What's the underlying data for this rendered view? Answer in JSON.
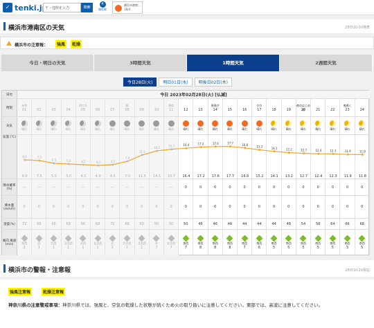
{
  "header": {
    "logo_text": "tenki.jp",
    "search_placeholder": "〒・住所を入力",
    "search_button": "検索",
    "notice_count": "4",
    "notice_label": "現在地",
    "mini_forecast": "横浜市港南... 18/4"
  },
  "page": {
    "title": "横浜市港南区の天気",
    "time": "28日10:00発表"
  },
  "warnings": {
    "label": "横浜市の注意報：",
    "items": [
      "強風",
      "乾燥"
    ]
  },
  "tabs": [
    "今日・明日の天気",
    "3時間天気",
    "1時間天気",
    "2週間天気"
  ],
  "active_tab": 2,
  "subtabs": [
    "今日28日(火)",
    "明日01日(水)",
    "明後日02日(木)"
  ],
  "table": {
    "date_label": "日付",
    "date_value": "今日 2023年02月28日(火) [仏滅]",
    "row_labels": {
      "hour": "時刻",
      "weather": "天気",
      "temp": "気温 (℃)",
      "precip_prob": "降水確率 (%)",
      "precip": "降水量 (mm/h)",
      "humidity": "湿度(%)",
      "wind": "風向 風速 (m/s)"
    },
    "periods": [
      "未明",
      "",
      "",
      "",
      "明け方",
      "",
      "",
      "朝",
      "",
      "",
      "昼前",
      "",
      "",
      "昼過ぎ",
      "",
      "",
      "夕方",
      "",
      "",
      "夜のはじめ頃",
      "",
      "",
      "夜遅く",
      ""
    ],
    "hours": [
      "01",
      "02",
      "03",
      "04",
      "05",
      "06",
      "07",
      "08",
      "09",
      "10",
      "11",
      "12",
      "13",
      "14",
      "15",
      "16",
      "17",
      "18",
      "19",
      "20",
      "21",
      "22",
      "23",
      "24"
    ],
    "weather": [
      "晴れ",
      "晴れ",
      "晴れ",
      "晴れ",
      "晴れ",
      "晴れ",
      "晴れ",
      "晴れ",
      "晴れ",
      "晴れ",
      "晴れ",
      "晴れ",
      "晴れ",
      "晴れ",
      "晴れ",
      "晴れ",
      "晴れ",
      "晴れ",
      "晴れ",
      "晴れ",
      "晴れ",
      "晴れ",
      "晴れ",
      "晴れ"
    ],
    "weather_icons": [
      "moon-icon",
      "moon-icon",
      "moon-icon",
      "moon-icon",
      "moon-icon",
      "moon-icon",
      "sun-icon",
      "sun-icon",
      "sun-icon",
      "sun-icon",
      "sun-icon",
      "sun-icon",
      "sun-icon",
      "sun-icon",
      "sun-icon",
      "sun-icon",
      "sun-icon",
      "moon-icon",
      "moon-icon",
      "moon-icon",
      "moon-icon",
      "moon-icon",
      "moon-icon",
      "moon-icon"
    ],
    "temps": [
      "8.0",
      "7.5",
      "5.5",
      "5.0",
      "4.5",
      "4.0",
      "4.5",
      "7.0",
      "11.5",
      "14.5",
      "15.7",
      "16.4",
      "17.2",
      "17.6",
      "17.7",
      "16.6",
      "15.2",
      "14.1",
      "13.2",
      "12.7",
      "12.4",
      "12.3",
      "11.9",
      "11.8"
    ],
    "temp_axis": [
      "最高",
      "20",
      "15",
      "10",
      "5",
      "0",
      "最低"
    ],
    "precip_prob": [
      "---",
      "---",
      "---",
      "---",
      "---",
      "---",
      "---",
      "---",
      "---",
      "---",
      "---",
      "0",
      "0",
      "0",
      "0",
      "0",
      "0",
      "0",
      "0",
      "0",
      "0",
      "0",
      "0",
      "0"
    ],
    "precip": [
      "0",
      "0",
      "0",
      "0",
      "0",
      "0",
      "0",
      "0",
      "0",
      "0",
      "0",
      "0",
      "0",
      "0",
      "0",
      "0",
      "0",
      "0",
      "0",
      "0",
      "0",
      "0",
      "0",
      "0"
    ],
    "humidity": [
      "72",
      "68",
      "66",
      "68",
      "66",
      "68",
      "70",
      "68",
      "60",
      "50",
      "50",
      "50",
      "46",
      "46",
      "46",
      "44",
      "44",
      "44",
      "48",
      "54",
      "58",
      "64",
      "66",
      "68"
    ],
    "wind_dir": [
      "南西",
      "西",
      "北西",
      "北北西",
      "北西",
      "北北西",
      "北",
      "北北西",
      "北北西",
      "北",
      "北北西",
      "南西",
      "南西",
      "南西",
      "南西",
      "南西",
      "南西",
      "南西",
      "南西",
      "南西",
      "南西",
      "南西",
      "南西",
      "南西"
    ],
    "wind_speed": [
      "2",
      "1",
      "1",
      "1",
      "1",
      "1",
      "1",
      "1",
      "1",
      "7",
      "7",
      "7",
      "8",
      "8",
      "8",
      "7",
      "6",
      "5",
      "5",
      "5",
      "5",
      "5",
      "5",
      "5"
    ]
  },
  "chart_data": {
    "type": "line",
    "x": [
      "01",
      "02",
      "03",
      "04",
      "05",
      "06",
      "07",
      "08",
      "09",
      "10",
      "11",
      "12",
      "13",
      "14",
      "15",
      "16",
      "17",
      "18",
      "19",
      "20",
      "21",
      "22",
      "23",
      "24"
    ],
    "series": [
      {
        "values": [
          8.0,
          7.5,
          5.5,
          5.0,
          4.5,
          4.0,
          4.5,
          7.0,
          11.5,
          14.5,
          15.7,
          16.4,
          17.2,
          17.6,
          17.7,
          16.6,
          15.2,
          14.1,
          13.2,
          12.7,
          12.4,
          12.3,
          11.9,
          11.8
        ]
      }
    ],
    "ylim": [
      0,
      20
    ],
    "color": "#f5a623"
  },
  "alert": {
    "title": "横浜市の警報・注意報",
    "time": "28日10:20現在",
    "tags": [
      "強風注意報",
      "乾燥注意報"
    ],
    "text_lead": "神奈川県の注意警戒事項：",
    "text_body": "神奈川県では、強風と、空気の乾燥した状態が続くため火の取り扱いに注意してください。東部では、高波に注意してください。"
  }
}
